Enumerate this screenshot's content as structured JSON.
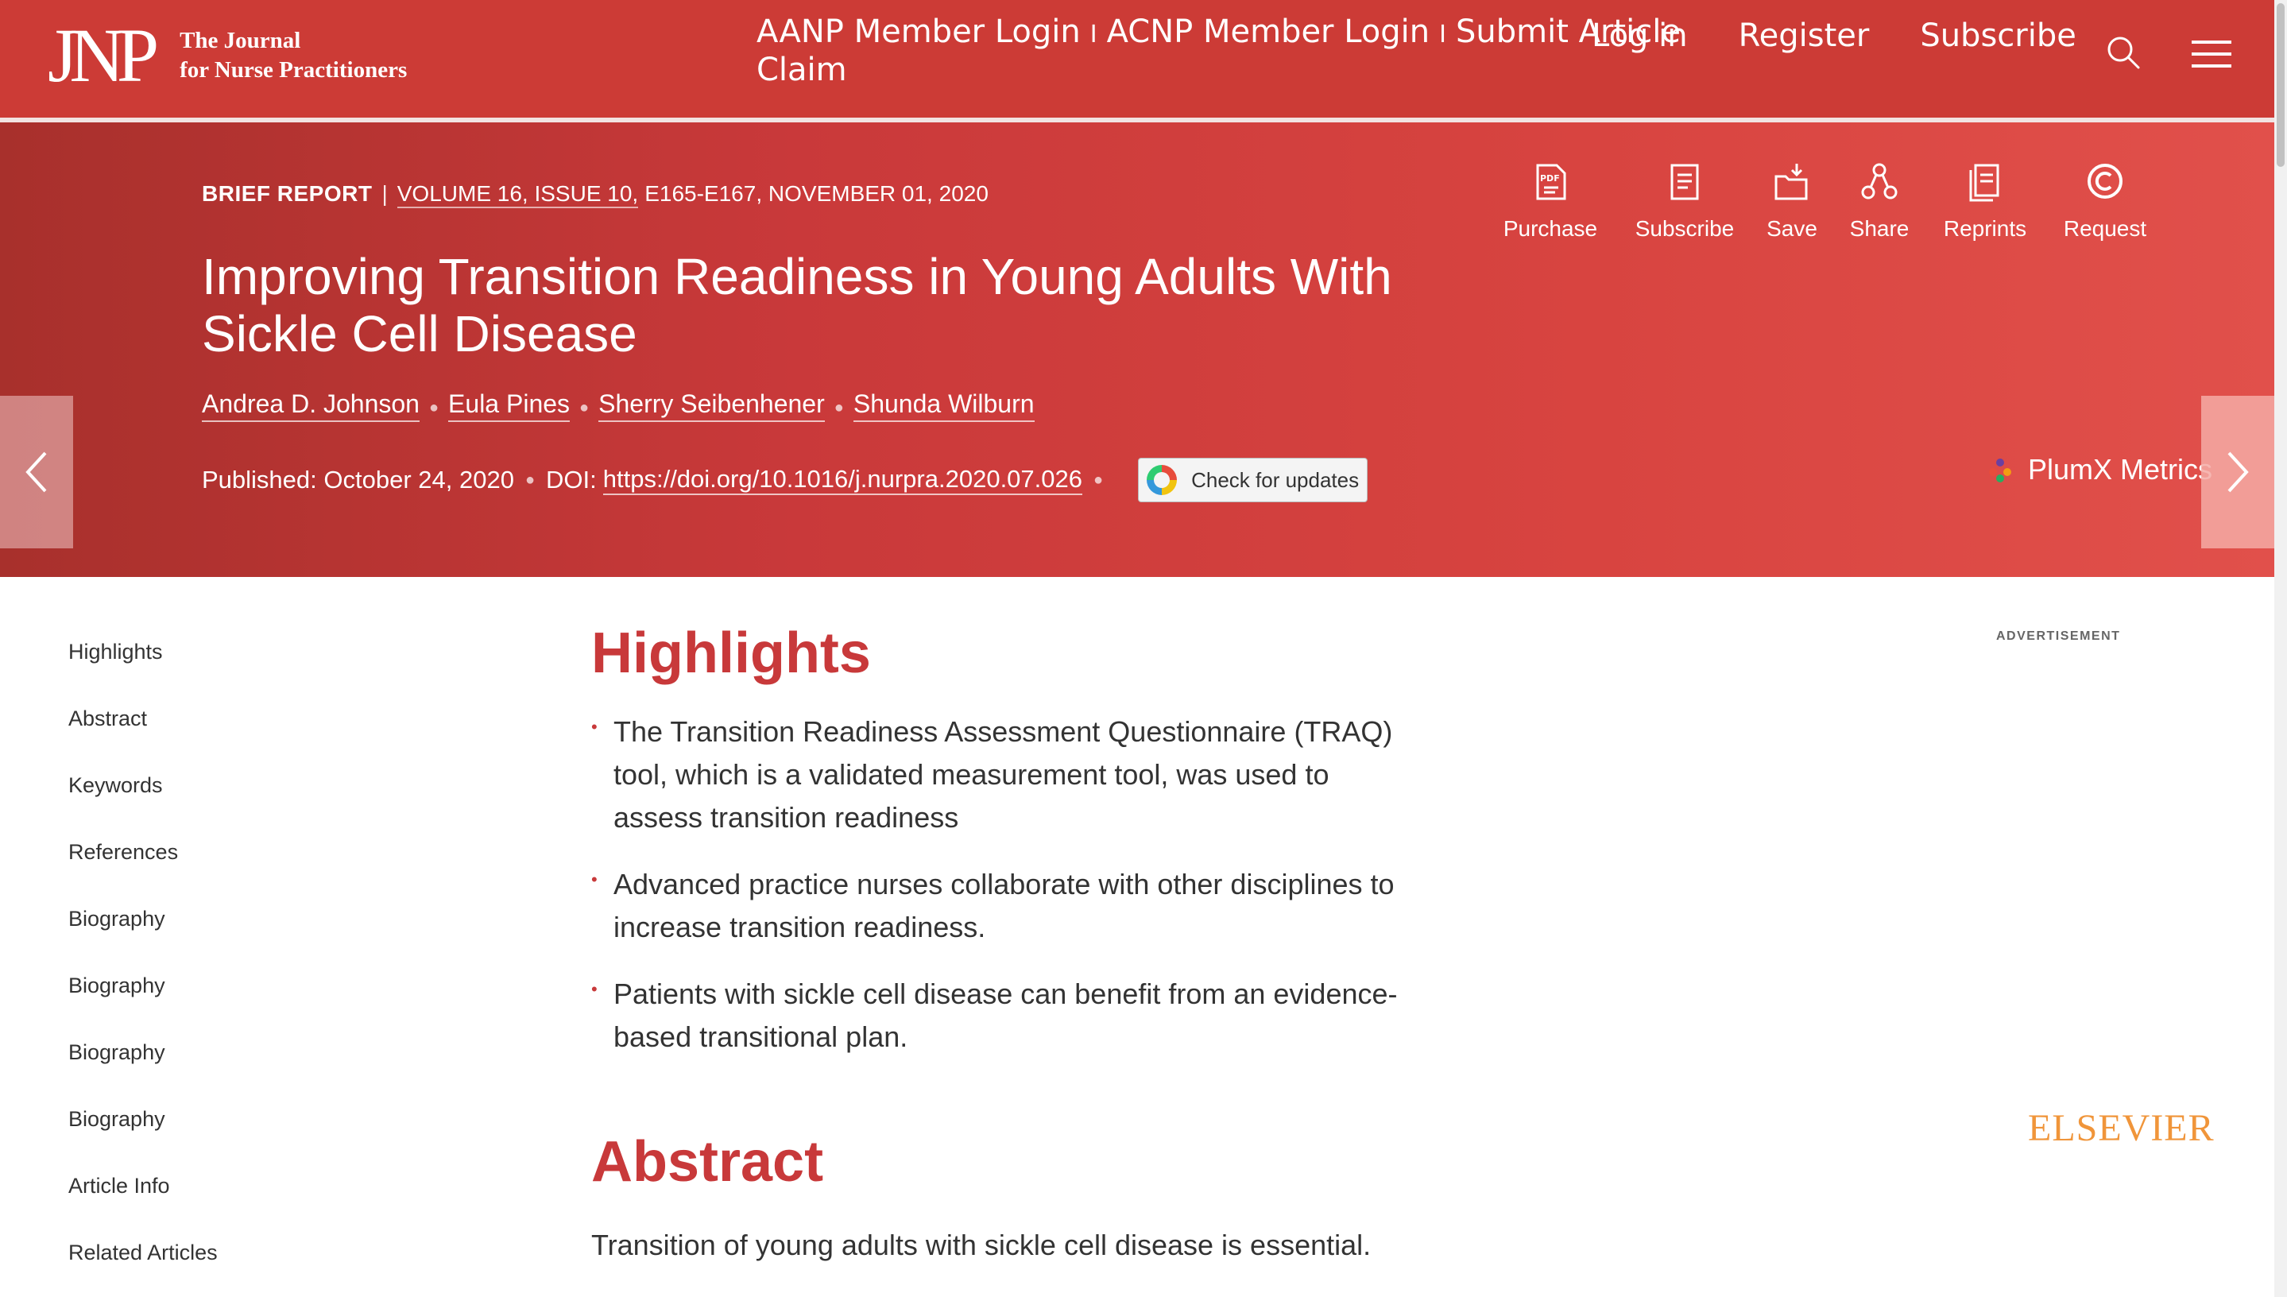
{
  "header": {
    "logo_mark": "JNP",
    "logo_line1": "The Journal",
    "logo_line2": "for Nurse Practitioners",
    "claim_links": [
      "AANP Member Login",
      "ACNP Member Login",
      "Submit Article"
    ],
    "claim_separator": "I",
    "claim_line2": "Claim",
    "nav": [
      "Log in",
      "Register",
      "Subscribe"
    ],
    "icons": [
      "search-icon",
      "menu-icon"
    ]
  },
  "hero": {
    "article_type": "BRIEF REPORT",
    "volume_info": "VOLUME 16, ISSUE 10,",
    "pages_date": "E165-E167, NOVEMBER 01, 2020",
    "title": "Improving Transition Readiness in Young Adults With Sickle Cell Disease",
    "authors": [
      "Andrea D. Johnson",
      "Eula Pines",
      "Sherry Seibenhener",
      "Shunda Wilburn"
    ],
    "published": "Published: October 24, 2020",
    "doi_label": "DOI:",
    "doi_url": "https://doi.org/10.1016/j.nurpra.2020.07.026",
    "check_updates": "Check for updates",
    "actions": [
      {
        "label": "Purchase",
        "icon": "pdf-icon"
      },
      {
        "label": "Subscribe",
        "icon": "document-icon"
      },
      {
        "label": "Save",
        "icon": "save-folder-icon"
      },
      {
        "label": "Share",
        "icon": "share-icon"
      },
      {
        "label": "Reprints",
        "icon": "reprints-icon"
      },
      {
        "label": "Request",
        "icon": "copyright-icon"
      }
    ],
    "plumx": "PlumX Metrics"
  },
  "sidebar": {
    "items": [
      "Highlights",
      "Abstract",
      "Keywords",
      "References",
      "Biography",
      "Biography",
      "Biography",
      "Biography",
      "Article Info",
      "Related Articles"
    ]
  },
  "main": {
    "highlights_title": "Highlights",
    "highlights": [
      "The Transition Readiness Assessment Questionnaire (TRAQ) tool, which is a validated measurement tool, was used to assess transition readiness",
      "Advanced practice nurses collaborate with other disciplines to increase transition readiness.",
      "Patients with sickle cell disease can benefit from an evidence-based transitional plan."
    ],
    "abstract_title": "Abstract",
    "abstract_text": "Transition of young adults with sickle cell disease is essential."
  },
  "right_rail": {
    "ad_label": "ADVERTISEMENT",
    "publisher": "ELSEVIER"
  },
  "colors": {
    "brand_red": "#cc3b36",
    "heading_red": "#c8393a",
    "elsevier_orange": "#f0953a"
  }
}
